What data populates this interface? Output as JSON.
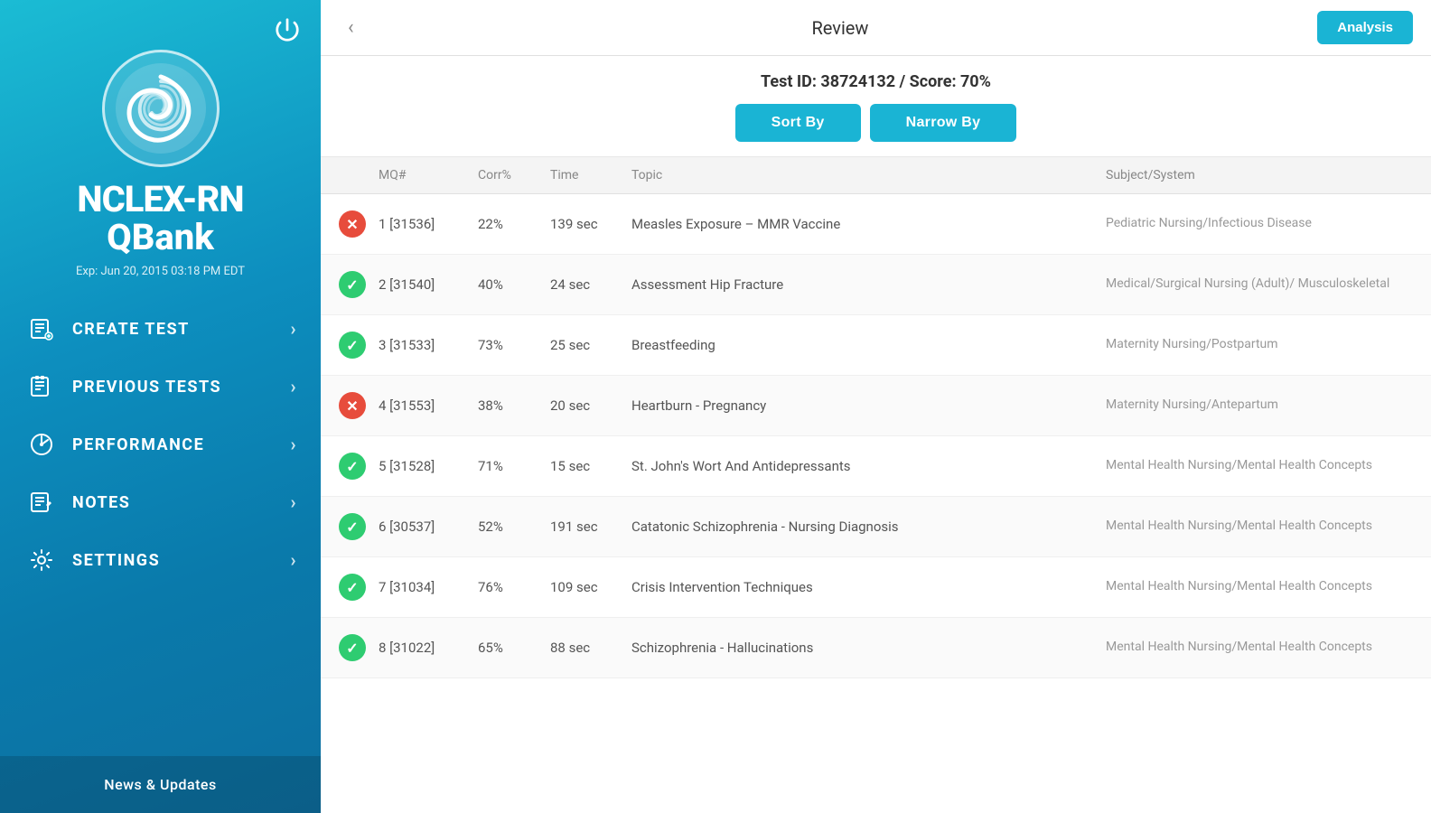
{
  "sidebar": {
    "power_icon": "⏻",
    "app_name_line1": "NCLEX-RN",
    "app_name_line2": "QBank",
    "expiry": "Exp: Jun 20, 2015 03:18 PM EDT",
    "nav_items": [
      {
        "id": "create-test",
        "label": "CREATE TEST",
        "icon": "📋"
      },
      {
        "id": "previous-tests",
        "label": "PREVIOUS TESTS",
        "icon": "📄"
      },
      {
        "id": "performance",
        "label": "PERFORMANCE",
        "icon": "📊"
      },
      {
        "id": "notes",
        "label": "NOTES",
        "icon": "📝"
      },
      {
        "id": "settings",
        "label": "SETTINGS",
        "icon": "⚙"
      }
    ],
    "news_label": "News & Updates"
  },
  "header": {
    "back_label": "‹",
    "title": "Review",
    "analysis_label": "Analysis"
  },
  "toolbar": {
    "test_info": "Test ID: 38724132 / Score: 70%",
    "sort_label": "Sort By",
    "narrow_label": "Narrow By"
  },
  "table": {
    "columns": {
      "mq": "MQ#",
      "corr": "Corr%",
      "time": "Time",
      "topic": "Topic",
      "subject": "Subject/System"
    },
    "rows": [
      {
        "status": "incorrect",
        "mq": "1 [31536]",
        "corr": "22%",
        "time": "139 sec",
        "topic": "Measles Exposure – MMR Vaccine",
        "subject": "Pediatric Nursing/Infectious Disease"
      },
      {
        "status": "correct",
        "mq": "2 [31540]",
        "corr": "40%",
        "time": "24 sec",
        "topic": "Assessment Hip Fracture",
        "subject": "Medical/Surgical Nursing (Adult)/ Musculoskeletal"
      },
      {
        "status": "correct",
        "mq": "3 [31533]",
        "corr": "73%",
        "time": "25 sec",
        "topic": "Breastfeeding",
        "subject": "Maternity Nursing/Postpartum"
      },
      {
        "status": "incorrect",
        "mq": "4 [31553]",
        "corr": "38%",
        "time": "20 sec",
        "topic": "Heartburn - Pregnancy",
        "subject": "Maternity Nursing/Antepartum"
      },
      {
        "status": "correct",
        "mq": "5 [31528]",
        "corr": "71%",
        "time": "15 sec",
        "topic": "St. John's Wort And Antidepressants",
        "subject": "Mental Health Nursing/Mental Health Concepts"
      },
      {
        "status": "correct",
        "mq": "6 [30537]",
        "corr": "52%",
        "time": "191 sec",
        "topic": "Catatonic Schizophrenia - Nursing Diagnosis",
        "subject": "Mental Health Nursing/Mental Health Concepts"
      },
      {
        "status": "correct",
        "mq": "7 [31034]",
        "corr": "76%",
        "time": "109 sec",
        "topic": "Crisis Intervention Techniques",
        "subject": "Mental Health Nursing/Mental Health Concepts"
      },
      {
        "status": "correct",
        "mq": "8 [31022]",
        "corr": "65%",
        "time": "88 sec",
        "topic": "Schizophrenia - Hallucinations",
        "subject": "Mental Health Nursing/Mental Health Concepts"
      }
    ]
  }
}
